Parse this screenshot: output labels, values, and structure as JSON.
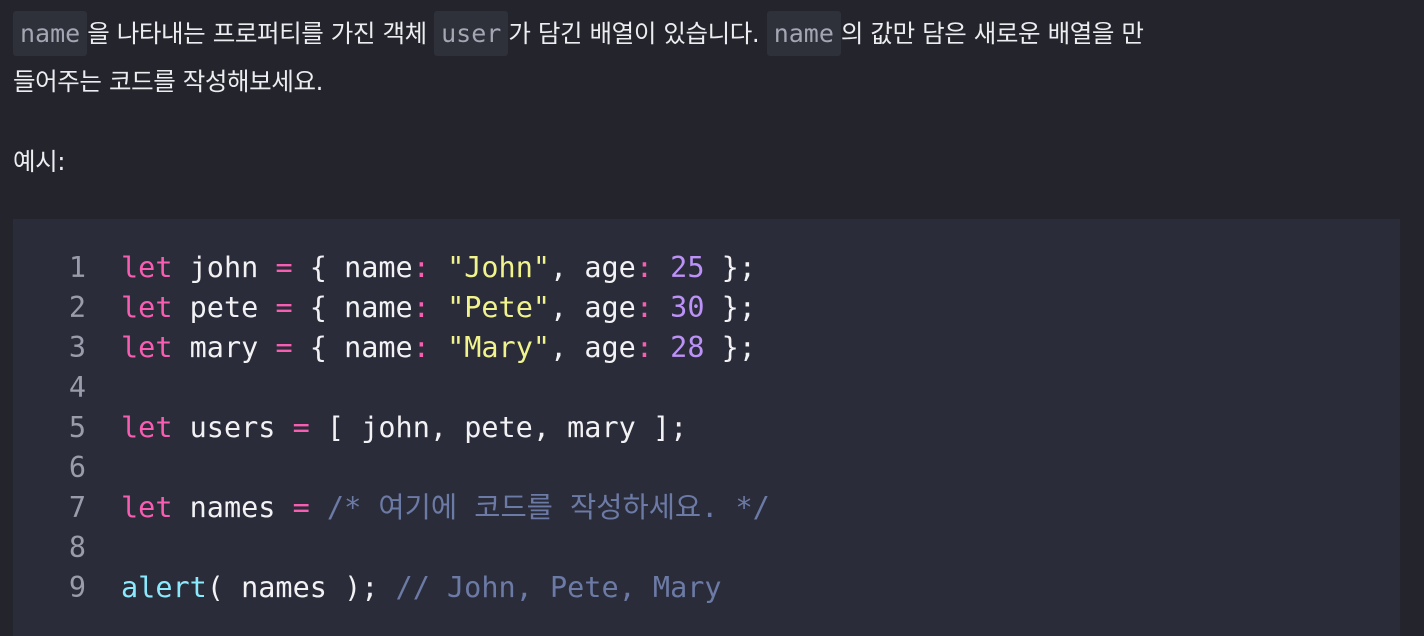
{
  "task": {
    "line1": {
      "code1": "name",
      "text1": "을 나타내는 프로퍼티를 가진 객체 ",
      "code2": "user",
      "text2": "가 담긴 배열이 있습니다. ",
      "code3": "name",
      "text3": "의 값만 담은 새로운 배열을 만"
    },
    "line2": "들어주는 코드를 작성해보세요.",
    "example_label": "예시:"
  },
  "code": {
    "lines": [
      {
        "n": "1",
        "kw": "let",
        "name": " john ",
        "eq": "=",
        "a": " { name",
        "c1": ":",
        "s1": " ",
        "str": "\"John\"",
        "b": ", age",
        "c2": ":",
        "s2": " ",
        "num": "25",
        "end": " };"
      },
      {
        "n": "2",
        "kw": "let",
        "name": " pete ",
        "eq": "=",
        "a": " { name",
        "c1": ":",
        "s1": " ",
        "str": "\"Pete\"",
        "b": ", age",
        "c2": ":",
        "s2": " ",
        "num": "30",
        "end": " };"
      },
      {
        "n": "3",
        "kw": "let",
        "name": " mary ",
        "eq": "=",
        "a": " { name",
        "c1": ":",
        "s1": " ",
        "str": "\"Mary\"",
        "b": ", age",
        "c2": ":",
        "s2": " ",
        "num": "28",
        "end": " };"
      },
      {
        "n": "4"
      },
      {
        "n": "5",
        "kw": "let",
        "name": " users ",
        "eq": "=",
        "rest": " [ john, pete, mary ];"
      },
      {
        "n": "6"
      },
      {
        "n": "7",
        "kw": "let",
        "name": " names ",
        "eq": "=",
        "comment": " /* 여기에 코드를 작성하세요. */"
      },
      {
        "n": "8"
      },
      {
        "n": "9",
        "fn": "alert",
        "rest": "( names ); ",
        "comment": "// John, Pete, Mary"
      }
    ]
  },
  "colors": {
    "background": "#24252c",
    "code_background": "#2a2c39",
    "keyword": "#f75eb2",
    "string": "#f1f38c",
    "number": "#bd92f8",
    "function": "#8be9fd",
    "comment": "#6c7aa6",
    "inline_code_bg": "#2e303a"
  }
}
